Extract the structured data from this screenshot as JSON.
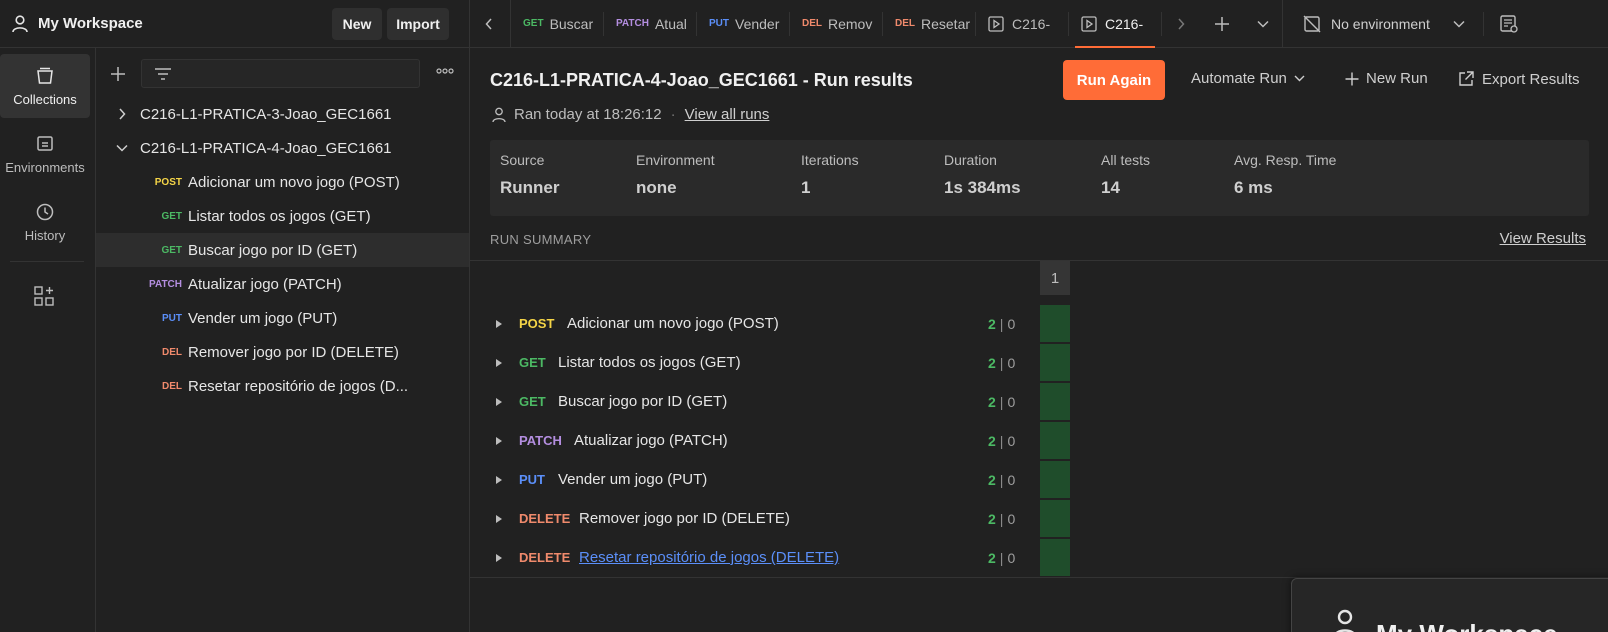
{
  "colors": {
    "accent": "#ff6c37",
    "post": "#f5d547",
    "get": "#4cb964",
    "patch": "#b48ee0",
    "put": "#5b8ff9",
    "delete": "#f08a6c",
    "pass": "#4cb964"
  },
  "header": {
    "workspace": "My Workspace",
    "new_label": "New",
    "import_label": "Import"
  },
  "tabs": [
    {
      "method": "GET",
      "label": "Buscar",
      "kind": "request"
    },
    {
      "method": "PATCH",
      "label": "Atual",
      "kind": "request"
    },
    {
      "method": "PUT",
      "label": "Vender",
      "kind": "request"
    },
    {
      "method": "DEL",
      "label": "Remov",
      "kind": "request"
    },
    {
      "method": "DEL",
      "label": "Resetar",
      "kind": "request"
    },
    {
      "method": "",
      "label": "C216-",
      "kind": "runner"
    },
    {
      "method": "",
      "label": "C216-",
      "kind": "runner",
      "active": true
    }
  ],
  "environment": {
    "label": "No environment"
  },
  "rail": [
    {
      "label": "Collections",
      "icon": "collections-icon"
    },
    {
      "label": "Environments",
      "icon": "environments-icon"
    },
    {
      "label": "History",
      "icon": "history-icon"
    }
  ],
  "sidebar": {
    "collections": [
      {
        "name": "C216-L1-PRATICA-3-Joao_GEC1661",
        "expanded": false
      },
      {
        "name": "C216-L1-PRATICA-4-Joao_GEC1661",
        "expanded": true
      }
    ],
    "requests": [
      {
        "method": "POST",
        "name": "Adicionar um novo jogo (POST)"
      },
      {
        "method": "GET",
        "name": "Listar todos os jogos (GET)"
      },
      {
        "method": "GET",
        "name": "Buscar jogo por ID (GET)",
        "selected": true
      },
      {
        "method": "PATCH",
        "name": "Atualizar jogo (PATCH)"
      },
      {
        "method": "PUT",
        "name": "Vender um jogo (PUT)"
      },
      {
        "method": "DEL",
        "name": "Remover jogo por ID (DELETE)"
      },
      {
        "method": "DEL",
        "name": "Resetar repositório de jogos (D..."
      }
    ]
  },
  "run": {
    "title": "C216-L1-PRATICA-4-Joao_GEC1661 - Run results",
    "run_again": "Run Again",
    "automate": "Automate Run",
    "new_run": "New Run",
    "export": "Export Results",
    "ran": "Ran today at 18:26:12",
    "dot": "·",
    "view_all": "View all runs",
    "stats": [
      {
        "label": "Source",
        "value": "Runner"
      },
      {
        "label": "Environment",
        "value": "none"
      },
      {
        "label": "Iterations",
        "value": "1"
      },
      {
        "label": "Duration",
        "value": "1s 384ms"
      },
      {
        "label": "All tests",
        "value": "14"
      },
      {
        "label": "Avg. Resp. Time",
        "value": "6 ms"
      }
    ],
    "summary_heading": "RUN SUMMARY",
    "view_results": "View Results",
    "iteration_col": "1",
    "results": [
      {
        "method": "POST",
        "name": "Adicionar um novo jogo (POST)",
        "passed": "2",
        "failed": "0"
      },
      {
        "method": "GET",
        "name": "Listar todos os jogos (GET)",
        "passed": "2",
        "failed": "0"
      },
      {
        "method": "GET",
        "name": "Buscar jogo por ID (GET)",
        "passed": "2",
        "failed": "0"
      },
      {
        "method": "PATCH",
        "name": "Atualizar jogo (PATCH)",
        "passed": "2",
        "failed": "0"
      },
      {
        "method": "PUT",
        "name": "Vender um jogo (PUT)",
        "passed": "2",
        "failed": "0"
      },
      {
        "method": "DELETE",
        "name": "Remover jogo por ID (DELETE)",
        "passed": "2",
        "failed": "0"
      },
      {
        "method": "DELETE",
        "name": "Resetar repositório de jogos (DELETE)",
        "passed": "2",
        "failed": "0",
        "link": true
      }
    ],
    "separator": "|"
  },
  "floating": {
    "title": "My Workspace"
  }
}
